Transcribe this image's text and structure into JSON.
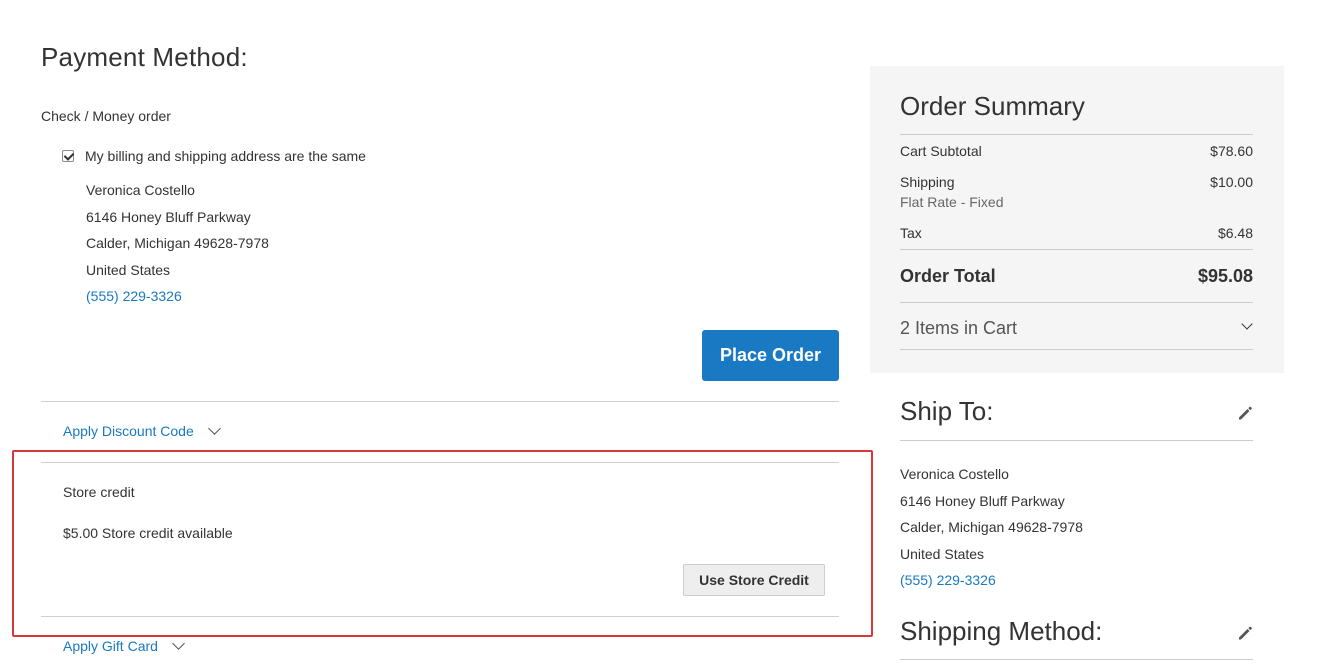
{
  "payment": {
    "title": "Payment Method:",
    "method_label": "Check / Money order",
    "same_address_label": "My billing and shipping address are the same",
    "same_address_checked": true,
    "billing_address": {
      "name": "Veronica Costello",
      "street": "6146 Honey Bluff Parkway",
      "city_line": "Calder, Michigan 49628-7978",
      "country": "United States",
      "phone": "(555) 229-3326"
    },
    "place_order_label": "Place Order",
    "discount_toggle_label": "Apply Discount Code",
    "store_credit": {
      "title": "Store credit",
      "available_text": "$5.00 Store credit available",
      "button_label": "Use Store Credit"
    },
    "gift_card_toggle_label": "Apply Gift Card"
  },
  "summary": {
    "title": "Order Summary",
    "cart_subtotal_label": "Cart Subtotal",
    "cart_subtotal_value": "$78.60",
    "shipping_label": "Shipping",
    "shipping_method": "Flat Rate - Fixed",
    "shipping_value": "$10.00",
    "tax_label": "Tax",
    "tax_value": "$6.48",
    "order_total_label": "Order Total",
    "order_total_value": "$95.08",
    "items_in_cart": "2 Items in Cart"
  },
  "ship_to": {
    "title": "Ship To:",
    "name": "Veronica Costello",
    "street": "6146 Honey Bluff Parkway",
    "city_line": "Calder, Michigan 49628-7978",
    "country": "United States",
    "phone": "(555) 229-3326"
  },
  "shipping_method_section": {
    "title": "Shipping Method:"
  },
  "colors": {
    "accent": "#1979c3",
    "highlight_border": "#d9383a",
    "summary_bg": "#f5f5f5"
  },
  "icons": {
    "edit": "pencil-icon",
    "expand": "chevron-down-icon"
  }
}
